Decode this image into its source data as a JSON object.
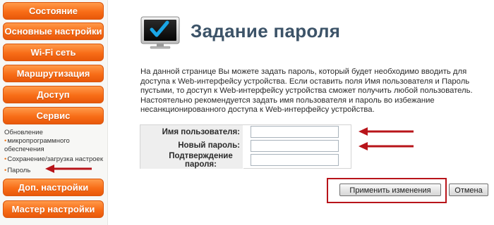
{
  "sidebar": {
    "menu": [
      {
        "label": "Состояние"
      },
      {
        "label": "Основные настройки"
      },
      {
        "label": "Wi-Fi сеть"
      },
      {
        "label": "Маршрутизация"
      },
      {
        "label": "Доступ"
      },
      {
        "label": "Сервис"
      },
      {
        "label": "Доп. настройки"
      },
      {
        "label": "Мастер настройки"
      }
    ],
    "service_submenu": [
      {
        "label_line1": "Обновление",
        "label_line2": "микропрограммного",
        "label_line3": "обеспечения"
      },
      {
        "label": "Сохранение/загрузка настроек"
      },
      {
        "label": "Пароль"
      }
    ]
  },
  "main": {
    "title": "Задание пароля",
    "description": "На данной странице Вы можете задать пароль, который будет необходимо вводить для доступа к Web-интерфейсу устройства. Если оставить поля Имя пользователя и Пароль пустыми, то доступ к Web-интерфейсу устройства сможет получить любой пользователь. Настоятельно рекомендуется задать имя пользователя и пароль во избежание несанкционированного доступа к Web-интерфейсу устройства.",
    "form": {
      "username_label": "Имя пользователя:",
      "username_value": "",
      "new_password_label": "Новый пароль:",
      "new_password_value": "",
      "confirm_label_line1": "Подтверждение",
      "confirm_label_line2": "пароля:",
      "confirm_value": ""
    },
    "buttons": {
      "apply_label": "Применить изменения",
      "cancel_label": "Отмена"
    }
  },
  "colors": {
    "nav_orange": "#f86d17",
    "title_blue": "#3c5368",
    "annotation_red": "#b8141a"
  },
  "icons": {
    "header_icon": "monitor-checkmark-icon"
  }
}
